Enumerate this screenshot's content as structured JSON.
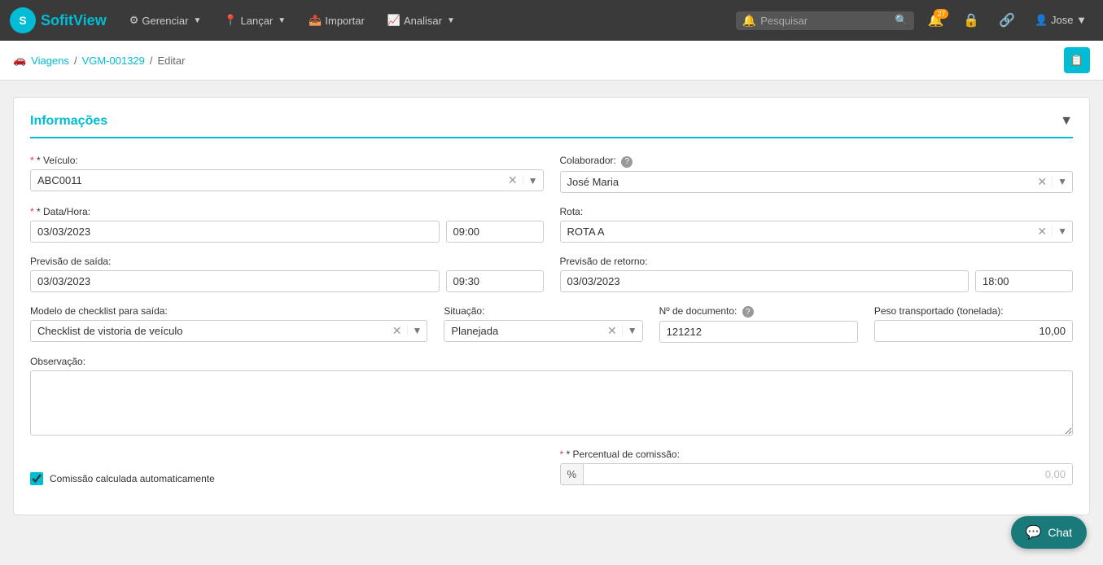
{
  "browser": {
    "url": "sofitview.com.br/#/client/trips/1329/edit"
  },
  "navbar": {
    "logo_text_normal": "Sofit",
    "logo_text_accent": "View",
    "menus": [
      {
        "id": "gerenciar",
        "label": "Gerenciar",
        "icon": "⚙"
      },
      {
        "id": "lancar",
        "label": "Lançar",
        "icon": "📍"
      },
      {
        "id": "importar",
        "label": "Importar",
        "icon": "📤"
      },
      {
        "id": "analisar",
        "label": "Analisar",
        "icon": "📈"
      }
    ],
    "search_placeholder": "Pesquisar",
    "notification_count": "27",
    "user_name": "Jose"
  },
  "breadcrumb": {
    "icon": "🏠",
    "viagens_label": "Viagens",
    "trip_id": "VGM-001329",
    "current": "Editar"
  },
  "card": {
    "title": "Informações",
    "sections": {
      "veiculo_label": "* Veículo:",
      "veiculo_value": "ABC0011",
      "colaborador_label": "Colaborador:",
      "colaborador_value": "José Maria",
      "data_hora_label": "* Data/Hora:",
      "data_value": "03/03/2023",
      "hora_value": "09:00",
      "rota_label": "Rota:",
      "rota_value": "ROTA A",
      "previsao_saida_label": "Previsão de saída:",
      "prev_saida_date": "03/03/2023",
      "prev_saida_time": "09:30",
      "previsao_retorno_label": "Previsão de retorno:",
      "prev_retorno_date": "03/03/2023",
      "prev_retorno_time": "18:00",
      "checklist_label": "Modelo de checklist para saída:",
      "checklist_value": "Checklist de vistoria de veículo",
      "situacao_label": "Situação:",
      "situacao_value": "Planejada",
      "ndoc_label": "Nº de documento:",
      "ndoc_value": "121212",
      "peso_label": "Peso transportado (tonelada):",
      "peso_value": "10,00",
      "observacao_label": "Observação:",
      "observacao_value": "",
      "comissao_label": "Comissão calculada automaticamente",
      "comissao_checked": true,
      "percentual_label": "* Percentual de comissão:",
      "percentual_prefix": "%",
      "percentual_value": "0,00"
    }
  },
  "chat": {
    "label": "Chat"
  }
}
